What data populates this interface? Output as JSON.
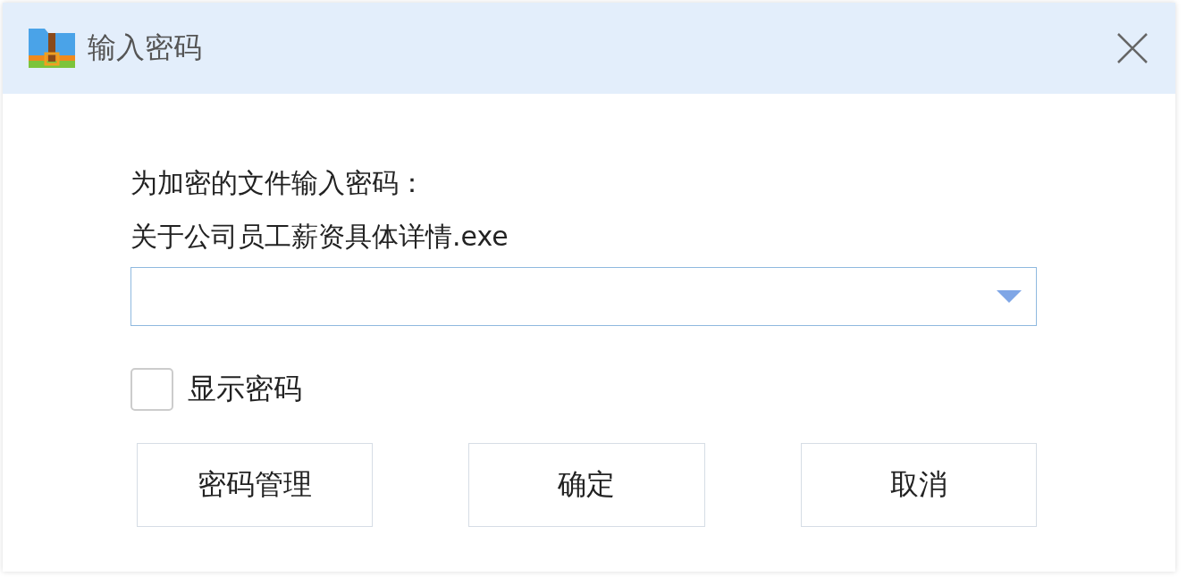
{
  "window": {
    "title": "输入密码"
  },
  "prompt": "为加密的文件输入密码：",
  "file_name": "关于公司员工薪资具体详情.exe",
  "show_password": {
    "label": "显示密码",
    "checked": false
  },
  "buttons": [
    "密码管理",
    "确定",
    "取消"
  ]
}
